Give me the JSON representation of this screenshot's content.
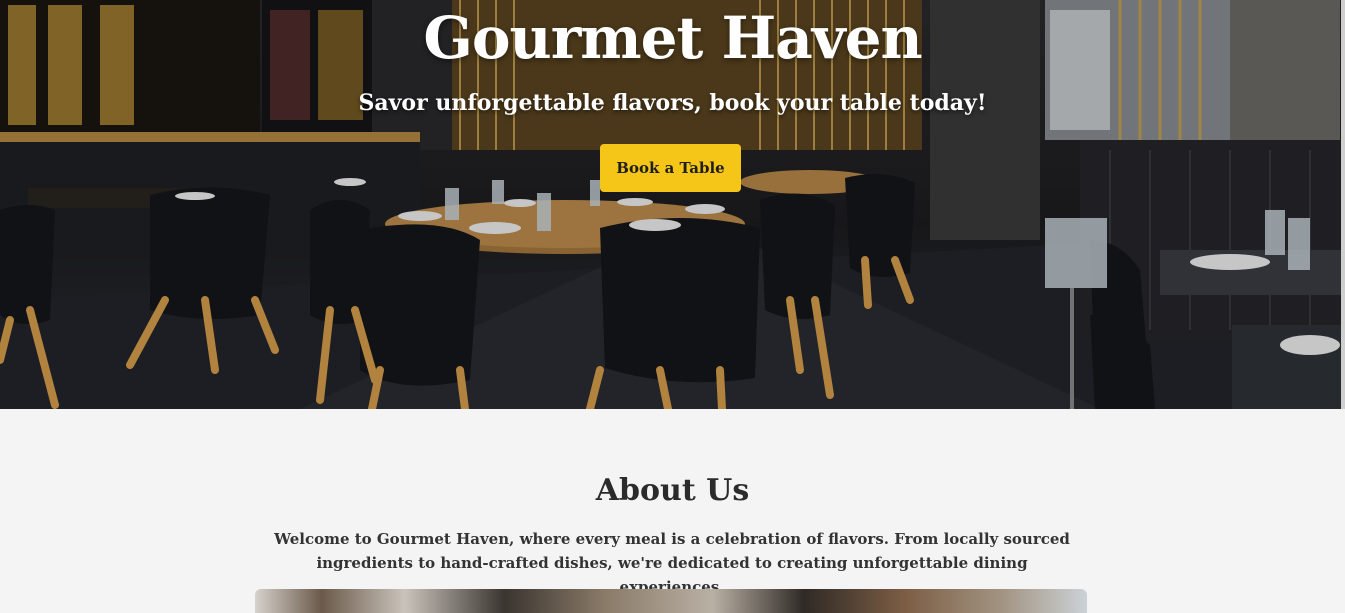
{
  "hero": {
    "title": "Gourmet Haven",
    "subtitle": "Savor unforgettable flavors, book your table today!",
    "cta_label": "Book a Table",
    "background_image": "restaurant-interior-photo"
  },
  "about": {
    "heading": "About Us",
    "text": "Welcome to Gourmet Haven, where every meal is a celebration of flavors. From locally sourced ingredients to hand-crafted dishes, we're dedicated to creating unforgettable dining experiences.",
    "image": "dining-photo"
  },
  "colors": {
    "accent": "#f5c518",
    "page_background": "#f4f4f4",
    "heading_text": "#2b2b2b"
  }
}
